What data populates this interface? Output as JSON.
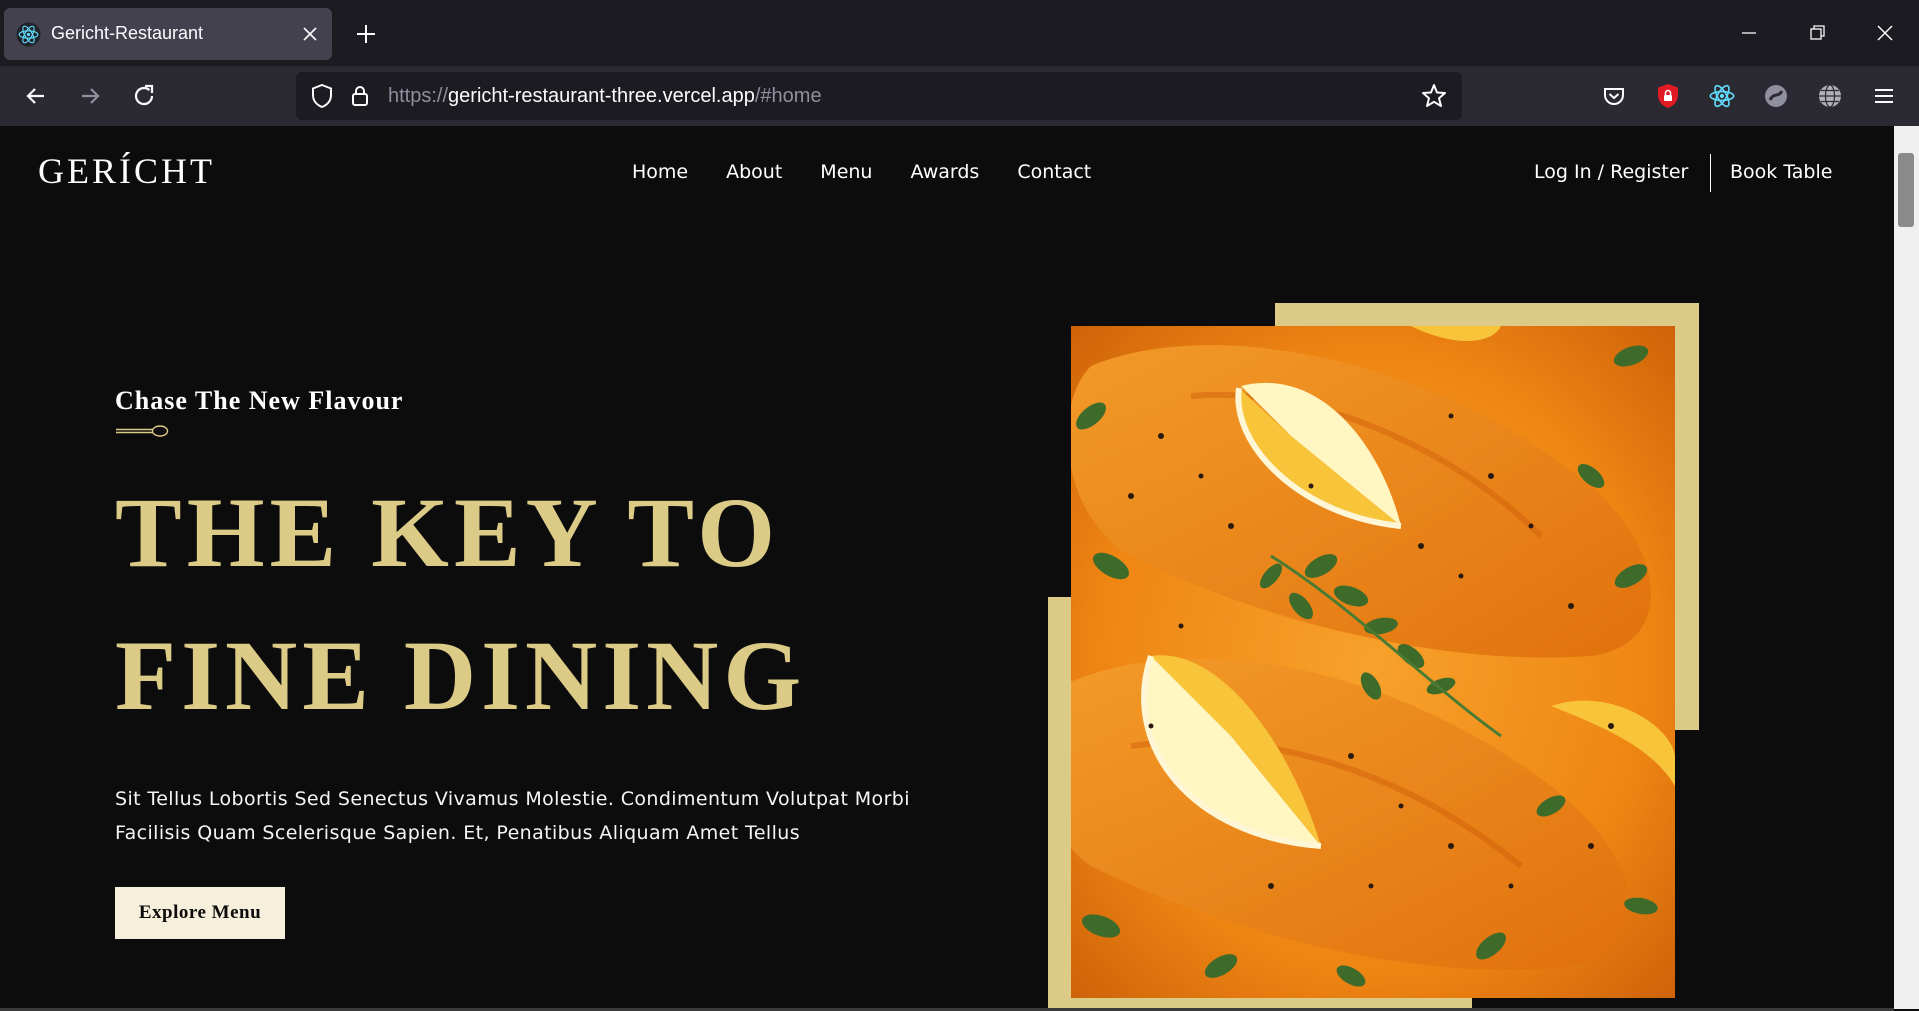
{
  "browser": {
    "tab_title": "Gericht-Restaurant",
    "url_scheme": "https://",
    "url_host": "gericht-restaurant-three.vercel.app",
    "url_path": "/#home"
  },
  "site": {
    "logo": "GERÍCHT",
    "nav": [
      "Home",
      "About",
      "Menu",
      "Awards",
      "Contact"
    ],
    "login_label": "Log In / Register",
    "book_label": "Book Table"
  },
  "hero": {
    "subtitle": "Chase The New Flavour",
    "headline_line1": "THE KEY TO",
    "headline_line2": "FINE DINING",
    "description": "Sit Tellus Lobortis Sed Senectus Vivamus Molestie. Condimentum Volutpat Morbi Facilisis Quam Scelerisque Sapien. Et, Penatibus Aliquam Amet Tellus",
    "button_label": "Explore Menu"
  },
  "colors": {
    "gold": "#dcca87",
    "page_bg": "#0c0c0c",
    "button_bg": "#f5efdb"
  },
  "icons": [
    "react-favicon-icon",
    "close-icon",
    "plus-icon",
    "minimize-icon",
    "restore-icon",
    "window-close-icon",
    "back-arrow-icon",
    "forward-arrow-icon",
    "reload-icon",
    "shield-icon",
    "lock-icon",
    "star-icon",
    "pocket-icon",
    "ublock-icon",
    "react-devtools-icon",
    "extension-icon",
    "globe-icon",
    "menu-icon",
    "spoon-icon"
  ]
}
